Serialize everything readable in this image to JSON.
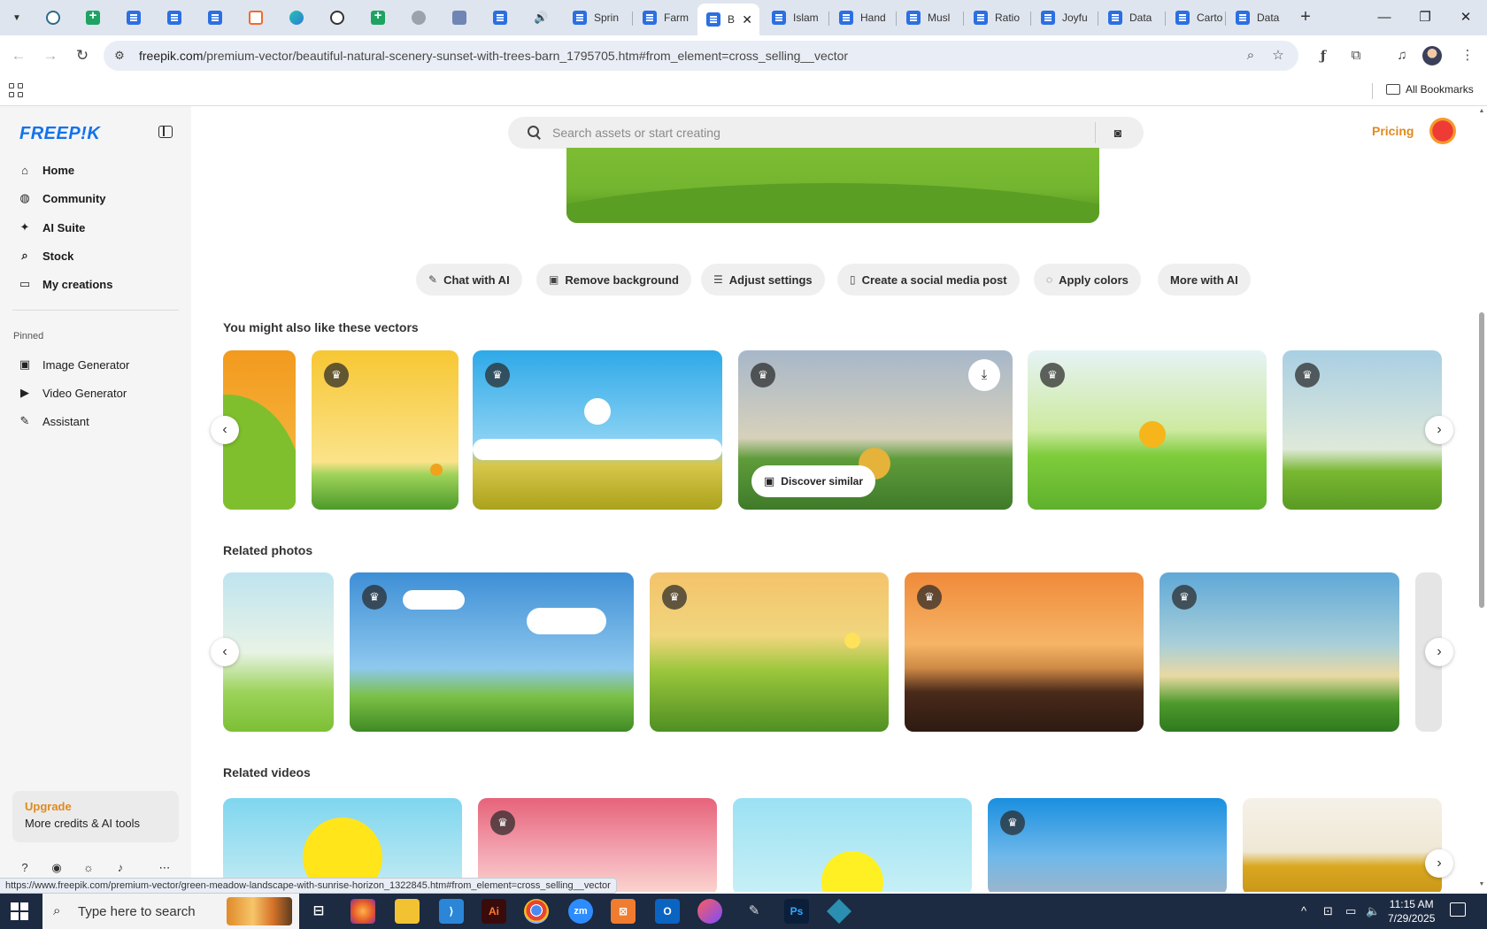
{
  "browser": {
    "tabs": [
      {
        "label": "Sprin",
        "icon": "docs"
      },
      {
        "label": "Farm",
        "icon": "docs"
      },
      {
        "label": "B",
        "icon": "docs",
        "active": true
      },
      {
        "label": "Islam",
        "icon": "docs"
      },
      {
        "label": "Hand",
        "icon": "docs"
      },
      {
        "label": "Musl",
        "icon": "docs"
      },
      {
        "label": "Ratio",
        "icon": "docs"
      },
      {
        "label": "Joyfu",
        "icon": "docs"
      },
      {
        "label": "Data",
        "icon": "docs"
      },
      {
        "label": "Carto",
        "icon": "docs"
      },
      {
        "label": "Data",
        "icon": "docs"
      }
    ],
    "url_host": "freepik.com",
    "url_path": "/premium-vector/beautiful-natural-scenery-sunset-with-trees-barn_1795705.htm#from_element=cross_selling__vector",
    "bookmarks_label": "All Bookmarks",
    "status_url": "https://www.freepik.com/premium-vector/green-meadow-landscape-with-sunrise-horizon_1322845.htm#from_element=cross_selling__vector"
  },
  "sidebar": {
    "logo": "FREEP!K",
    "nav": [
      {
        "label": "Home",
        "icon": "home-icon"
      },
      {
        "label": "Community",
        "icon": "globe-icon"
      },
      {
        "label": "AI Suite",
        "icon": "sparkle-icon"
      },
      {
        "label": "Stock",
        "icon": "search-icon"
      },
      {
        "label": "My creations",
        "icon": "folder-icon"
      }
    ],
    "pinned_label": "Pinned",
    "pinned": [
      {
        "label": "Image Generator",
        "icon": "image-icon"
      },
      {
        "label": "Video Generator",
        "icon": "video-icon"
      },
      {
        "label": "Assistant",
        "icon": "chat-icon"
      }
    ],
    "upgrade": {
      "title": "Upgrade",
      "subtitle": "More credits & AI tools"
    }
  },
  "header": {
    "search_placeholder": "Search assets or start creating",
    "pricing": "Pricing"
  },
  "ai_actions": [
    "Chat with AI",
    "Remove background",
    "Adjust settings",
    "Create a social media post",
    "Apply colors",
    "More with AI"
  ],
  "sections": {
    "vectors": {
      "title": "You might also like these vectors",
      "discover": "Discover similar"
    },
    "photos": {
      "title": "Related photos"
    },
    "videos": {
      "title": "Related videos"
    }
  },
  "taskbar": {
    "search_text": "Type here to search",
    "time": "11:15 AM",
    "date": "7/29/2025"
  }
}
